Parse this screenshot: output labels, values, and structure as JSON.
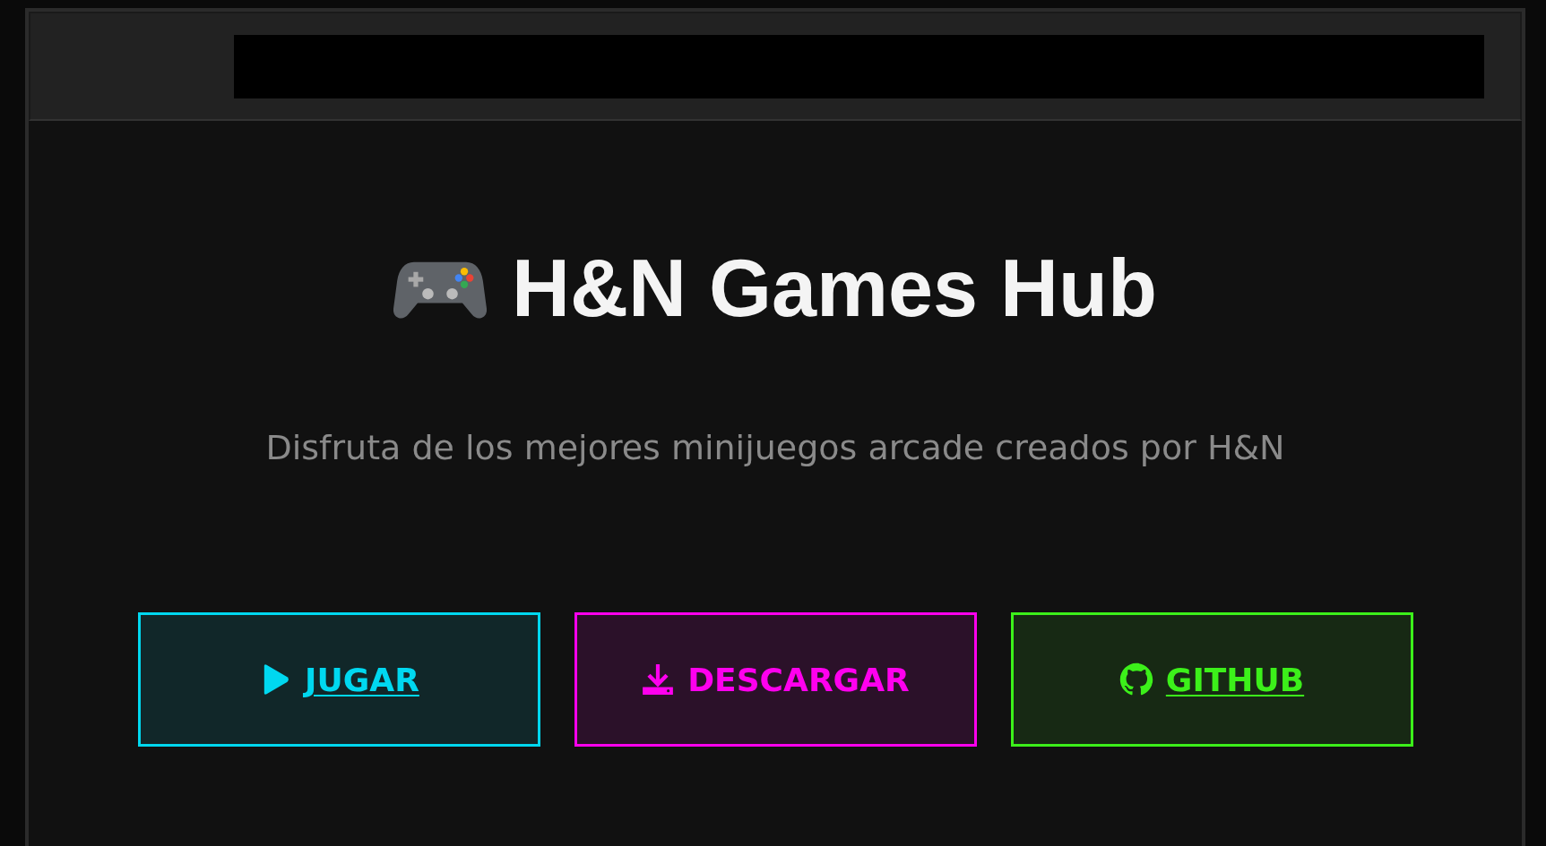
{
  "header": {
    "redacted": true
  },
  "title": {
    "text": "H&N Games Hub"
  },
  "subtitle": "Disfruta de los mejores minijuegos arcade creados por H&N",
  "buttons": [
    {
      "kind": "play",
      "label": "JUGAR",
      "color": "#00d8f0",
      "underlined": true
    },
    {
      "kind": "download",
      "label": "DESCARGAR",
      "color": "#ff00ee",
      "underlined": false
    },
    {
      "kind": "github",
      "label": "GITHUB",
      "color": "#3cf01a",
      "underlined": true
    }
  ]
}
